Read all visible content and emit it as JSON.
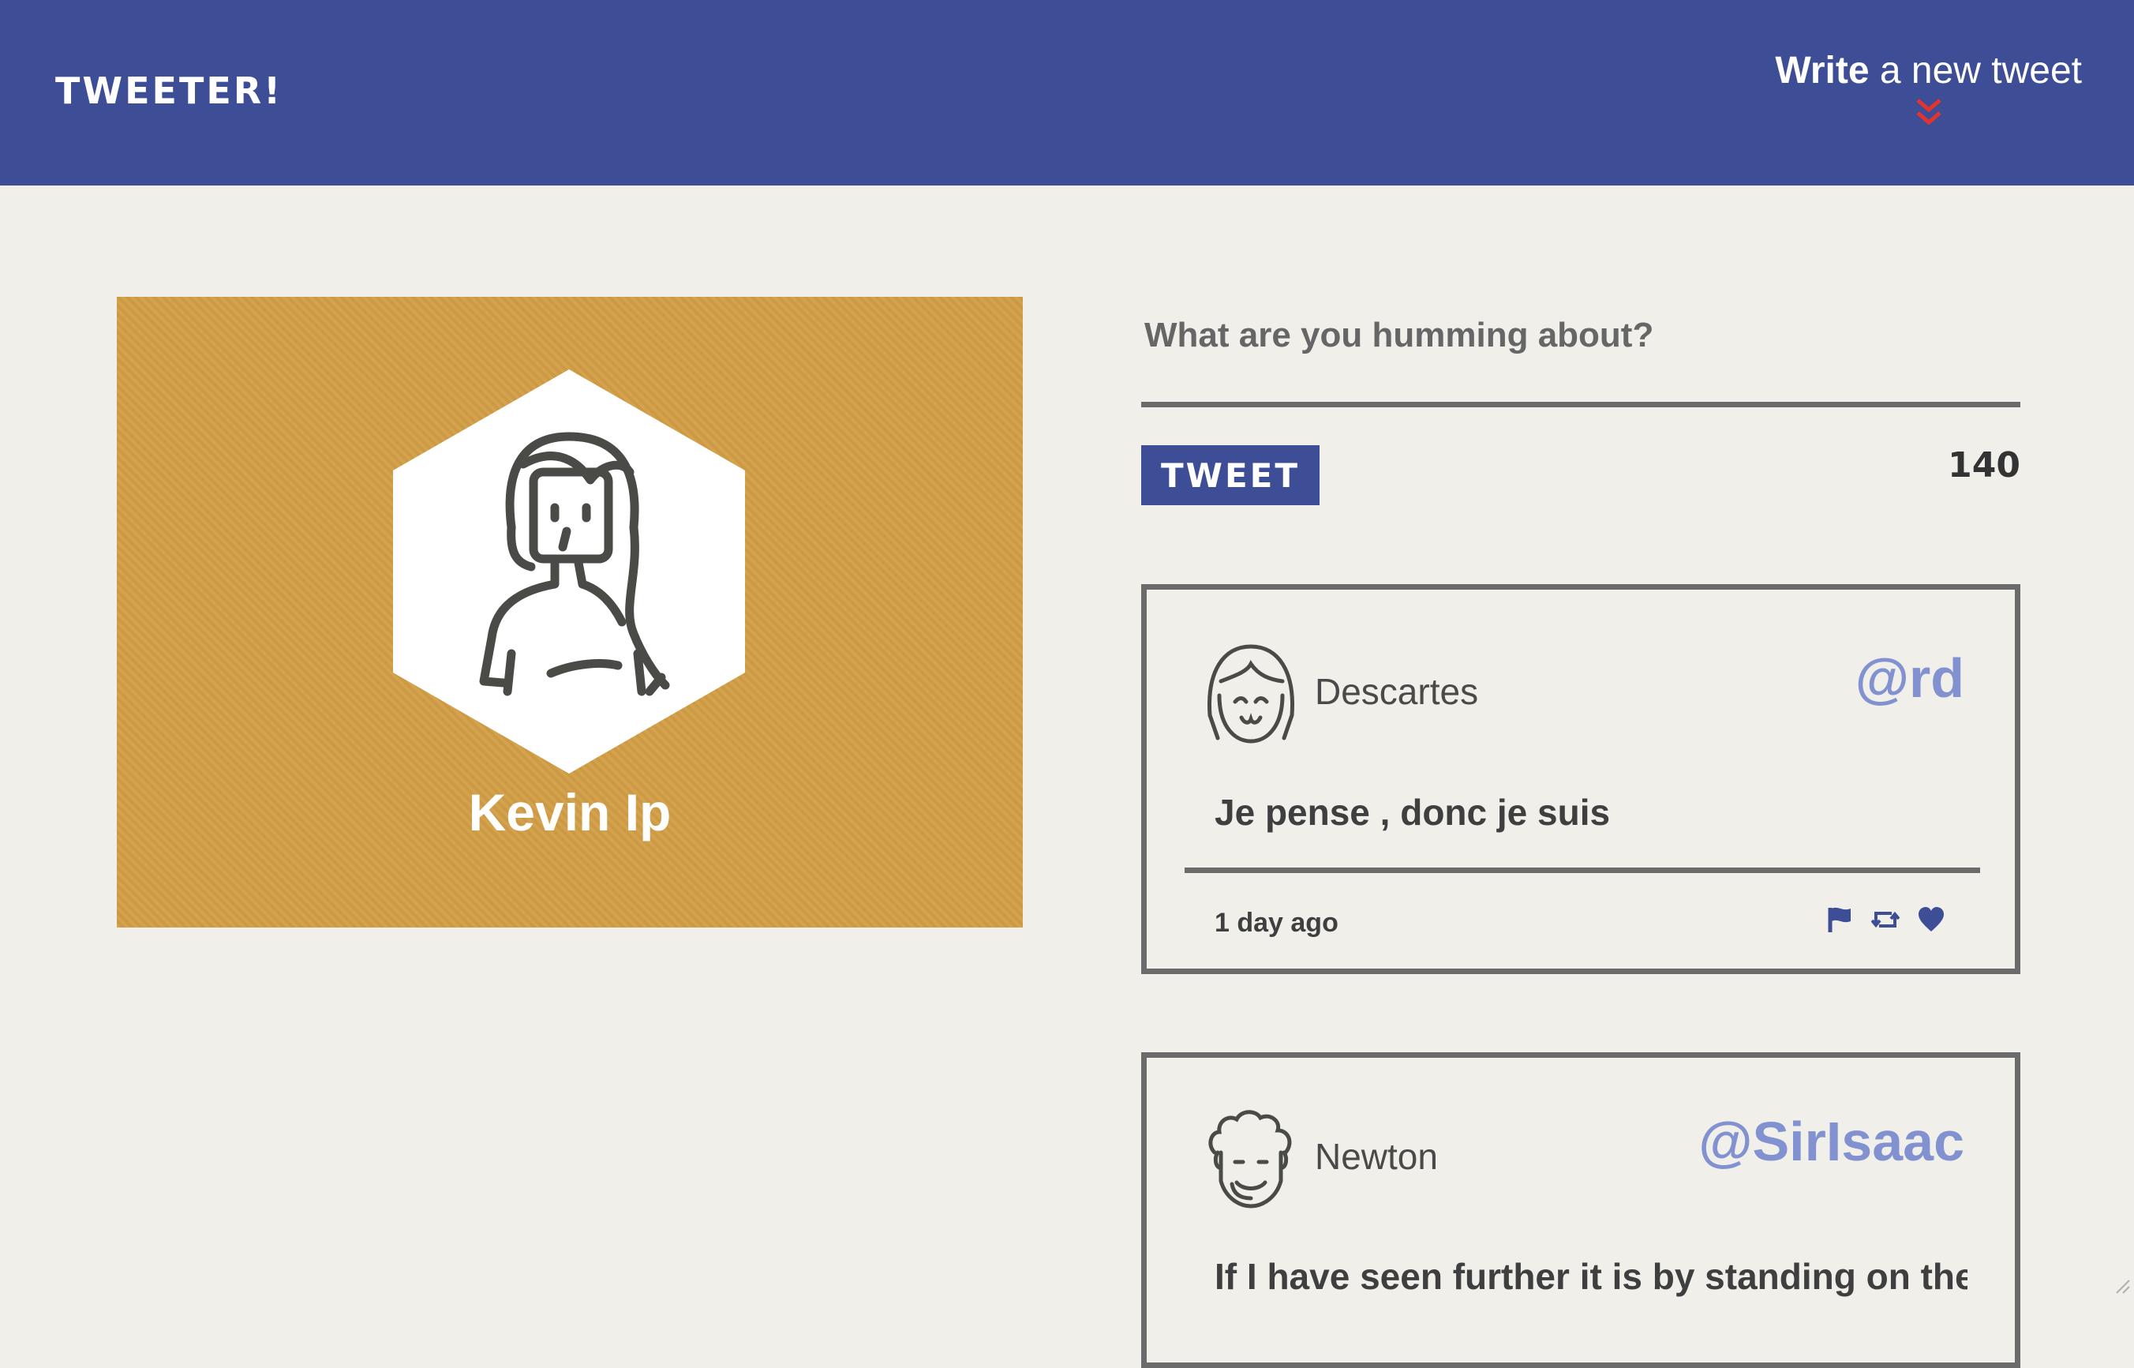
{
  "header": {
    "brand": "TWEETER!",
    "compose_toggle_bold": "Write",
    "compose_toggle_rest": " a new tweet",
    "toggle_icon": "double-chevron-down-icon",
    "toggle_icon_color": "#e5322d"
  },
  "profile": {
    "name": "Kevin Ip",
    "avatar_icon": "woman-avatar-icon"
  },
  "compose": {
    "placeholder": "What are you humming about?",
    "value": "",
    "button_label": "TWEET",
    "counter": "140"
  },
  "tweets": [
    {
      "name": "Descartes",
      "handle": "@rd",
      "avatar_icon": "girl-avatar-icon",
      "text": "Je pense , donc je suis",
      "time": "1 day ago",
      "actions": [
        "flag-icon",
        "retweet-icon",
        "heart-icon"
      ]
    },
    {
      "name": "Newton",
      "handle": "@SirIsaac",
      "avatar_icon": "curly-hair-man-avatar-icon",
      "text": "If I have seen further it is by standing on the"
    }
  ],
  "colors": {
    "header_bg": "#3e4e96",
    "page_bg": "#f1efea",
    "profile_bg": "#d39f46",
    "handle": "#8291cf",
    "border": "#6b6b6b"
  }
}
